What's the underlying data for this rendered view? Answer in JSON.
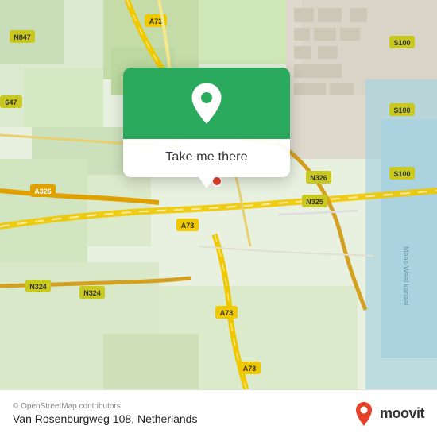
{
  "map": {
    "alt": "Map of Van Rosenburgweg 108, Netherlands"
  },
  "popup": {
    "button_label": "Take me there"
  },
  "footer": {
    "copyright": "© OpenStreetMap contributors",
    "address": "Van Rosenburgweg 108, Netherlands",
    "brand": "moovit"
  },
  "colors": {
    "green_pin_bg": "#2baa5e",
    "road_yellow": "#f5d100",
    "road_orange": "#e8a000",
    "water_blue": "#aad3df",
    "land_green": "#e8f0e0",
    "moovit_red": "#e8412a"
  }
}
